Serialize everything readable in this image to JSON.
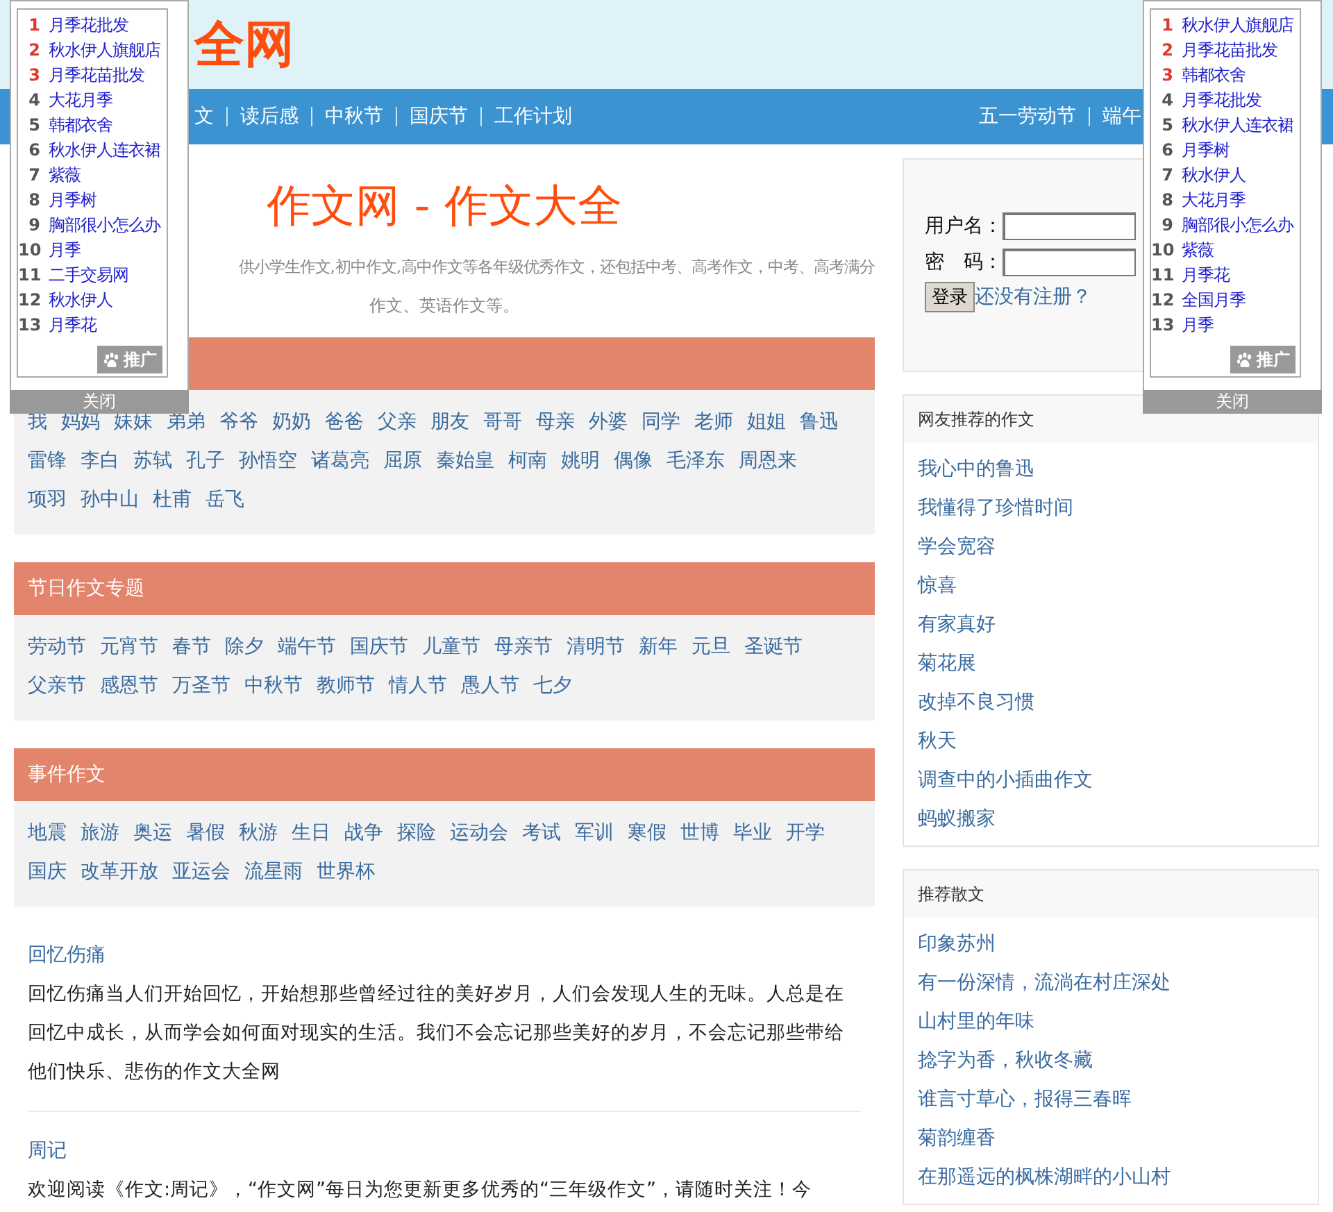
{
  "header": {
    "logo": "全网"
  },
  "nav": {
    "left": [
      "文",
      "读后感",
      "中秋节",
      "国庆节",
      "工作计划"
    ],
    "right": [
      "五一劳动节",
      "端午"
    ]
  },
  "intro": {
    "title": "作文网 - 作文大全",
    "lines": [
      "供小学生作文,初中作文,高中作文等各年级优秀作文，还包括中考、高考作文，中考、高考满分",
      "作文、英语作文等。"
    ]
  },
  "sections": [
    {
      "tags": [
        "我",
        "妈妈",
        "妹妹",
        "弟弟",
        "爷爷",
        "奶奶",
        "爸爸",
        "父亲",
        "朋友",
        "哥哥",
        "母亲",
        "外婆",
        "同学",
        "老师",
        "姐姐",
        "鲁迅",
        "雷锋",
        "李白",
        "苏轼",
        "孔子",
        "孙悟空",
        "诸葛亮",
        "屈原",
        "秦始皇",
        "柯南",
        "姚明",
        "偶像",
        "毛泽东",
        "周恩来",
        "项羽",
        "孙中山",
        "杜甫",
        "岳飞"
      ]
    },
    {
      "title": "节日作文专题",
      "tags": [
        "劳动节",
        "元宵节",
        "春节",
        "除夕",
        "端午节",
        "国庆节",
        "儿童节",
        "母亲节",
        "清明节",
        "新年",
        "元旦",
        "圣诞节",
        "父亲节",
        "感恩节",
        "万圣节",
        "中秋节",
        "教师节",
        "情人节",
        "愚人节",
        "七夕"
      ]
    },
    {
      "title": "事件作文",
      "tags": [
        "地震",
        "旅游",
        "奥运",
        "暑假",
        "秋游",
        "生日",
        "战争",
        "探险",
        "运动会",
        "考试",
        "军训",
        "寒假",
        "世博",
        "毕业",
        "开学",
        "国庆",
        "改革开放",
        "亚运会",
        "流星雨",
        "世界杯"
      ]
    }
  ],
  "articles": [
    {
      "title": "回忆伤痛",
      "body": "回忆伤痛当人们开始回忆，开始想那些曾经过往的美好岁月，人们会发现人生的无味。人总是在回忆中成长，从而学会如何面对现实的生活。我们不会忘记那些美好的岁月，不会忘记那些带给他们快乐、悲伤的作文大全网"
    },
    {
      "title": "周记",
      "body": "欢迎阅读《作文:周记》，“作文网”每日为您更新更多优秀的“三年级作文”，请随时关注！今"
    }
  ],
  "login": {
    "username_label": "用户名：",
    "password_label": "密　码：",
    "button": "登录",
    "register_link": "还没有注册？"
  },
  "boxes": [
    {
      "title": "网友推荐的作文",
      "items": [
        "我心中的鲁迅",
        "我懂得了珍惜时间",
        "学会宽容",
        "惊喜",
        "有家真好",
        "菊花展",
        "改掉不良习惯",
        "秋天",
        "调查中的小插曲作文",
        "蚂蚁搬家"
      ]
    },
    {
      "title": "推荐散文",
      "items": [
        "印象苏州",
        "有一份深情，流淌在村庄深处",
        "山村里的年味",
        "捻字为香，秋收冬藏",
        "谁言寸草心，报得三春晖",
        "菊韵缠香",
        "在那遥远的枫株湖畔的小山村"
      ]
    }
  ],
  "popups": [
    {
      "items": [
        {
          "rank": "1",
          "text": "月季花批发",
          "hot": true
        },
        {
          "rank": "2",
          "text": "秋水伊人旗舰店",
          "hot": true
        },
        {
          "rank": "3",
          "text": "月季花苗批发",
          "hot": true
        },
        {
          "rank": "4",
          "text": "大花月季",
          "hot": false
        },
        {
          "rank": "5",
          "text": "韩都衣舍",
          "hot": false
        },
        {
          "rank": "6",
          "text": "秋水伊人连衣裙",
          "hot": false
        },
        {
          "rank": "7",
          "text": "紫薇",
          "hot": false
        },
        {
          "rank": "8",
          "text": "月季树",
          "hot": false
        },
        {
          "rank": "9",
          "text": "胸部很小怎么办",
          "hot": false
        },
        {
          "rank": "10",
          "text": "月季",
          "hot": false
        },
        {
          "rank": "11",
          "text": "二手交易网",
          "hot": false
        },
        {
          "rank": "12",
          "text": "秋水伊人",
          "hot": false
        },
        {
          "rank": "13",
          "text": "月季花",
          "hot": false
        }
      ],
      "promo": "推广",
      "close": "关闭"
    },
    {
      "items": [
        {
          "rank": "1",
          "text": "秋水伊人旗舰店",
          "hot": true
        },
        {
          "rank": "2",
          "text": "月季花苗批发",
          "hot": true
        },
        {
          "rank": "3",
          "text": "韩都衣舍",
          "hot": true
        },
        {
          "rank": "4",
          "text": "月季花批发",
          "hot": false
        },
        {
          "rank": "5",
          "text": "秋水伊人连衣裙",
          "hot": false
        },
        {
          "rank": "6",
          "text": "月季树",
          "hot": false
        },
        {
          "rank": "7",
          "text": "秋水伊人",
          "hot": false
        },
        {
          "rank": "8",
          "text": "大花月季",
          "hot": false
        },
        {
          "rank": "9",
          "text": "胸部很小怎么办",
          "hot": false
        },
        {
          "rank": "10",
          "text": "紫薇",
          "hot": false
        },
        {
          "rank": "11",
          "text": "月季花",
          "hot": false
        },
        {
          "rank": "12",
          "text": "全国月季",
          "hot": false
        },
        {
          "rank": "13",
          "text": "月季",
          "hot": false
        }
      ],
      "promo": "推广",
      "close": "关闭"
    }
  ]
}
